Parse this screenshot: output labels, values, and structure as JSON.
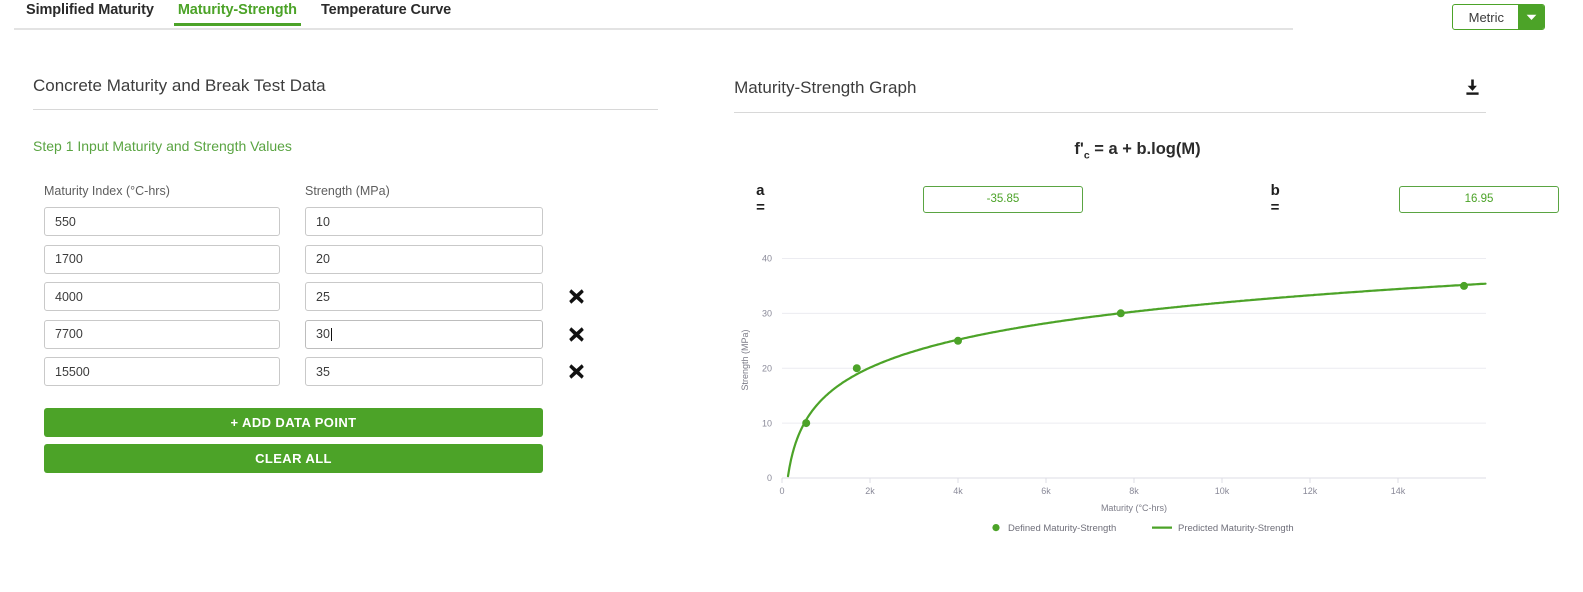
{
  "tabs": [
    {
      "label": "Simplified Maturity",
      "active": false
    },
    {
      "label": "Maturity-Strength",
      "active": true
    },
    {
      "label": "Temperature Curve",
      "active": false
    }
  ],
  "unit_selector": {
    "value": "Metric",
    "caret_icon": "chevron-down-icon"
  },
  "left_panel": {
    "title": "Concrete Maturity and Break Test Data",
    "step_label": "Step 1 Input Maturity and Strength Values",
    "headers": {
      "maturity": "Maturity Index (°C-hrs)",
      "strength": "Strength (MPa)"
    },
    "rows": [
      {
        "maturity": "550",
        "strength": "10",
        "deletable": false,
        "focused": false
      },
      {
        "maturity": "1700",
        "strength": "20",
        "deletable": false,
        "focused": false
      },
      {
        "maturity": "4000",
        "strength": "25",
        "deletable": true,
        "focused": false
      },
      {
        "maturity": "7700",
        "strength": "30",
        "deletable": true,
        "focused": true
      },
      {
        "maturity": "15500",
        "strength": "35",
        "deletable": true,
        "focused": false
      }
    ],
    "delete_icon": "close-x-icon",
    "add_button": "+ ADD DATA POINT",
    "clear_button": "CLEAR ALL"
  },
  "right_panel": {
    "title": "Maturity-Strength Graph",
    "download_icon": "download-icon",
    "formula": {
      "lhs": "f'",
      "lhs_sub": "c",
      "rhs": " = a + b.log(M)"
    },
    "coefficients": [
      {
        "label": "a =",
        "value": "-35.85"
      },
      {
        "label": "b =",
        "value": "16.95"
      }
    ]
  },
  "colors": {
    "green": "#4ca328",
    "green_text": "#5aa442",
    "grid": "#ececf1",
    "axis_text": "#8a8a99"
  },
  "chart_data": {
    "type": "scatter",
    "title": "",
    "xlabel": "Maturity (°C-hrs)",
    "ylabel": "Strength (MPa)",
    "xlim": [
      0,
      16000
    ],
    "ylim": [
      0,
      43
    ],
    "xticks": [
      0,
      2000,
      4000,
      6000,
      8000,
      10000,
      12000,
      14000
    ],
    "xticklabels": [
      "0",
      "2k",
      "4k",
      "6k",
      "8k",
      "10k",
      "12k",
      "14k"
    ],
    "yticks": [
      0,
      10,
      20,
      30,
      40
    ],
    "yticklabels": [
      "0",
      "10",
      "20",
      "30",
      "40"
    ],
    "grid": true,
    "legend_position": "bottom",
    "series": [
      {
        "name": "Defined Maturity-Strength",
        "type": "scatter",
        "color": "#4ca328",
        "x": [
          550,
          1700,
          4000,
          7700,
          15500
        ],
        "y": [
          10,
          20,
          25,
          30,
          35
        ]
      },
      {
        "name": "Predicted Maturity-Strength",
        "type": "line",
        "color": "#4ca328",
        "model": "f'c = a + b.log10(M)",
        "a": -35.85,
        "b": 16.95
      }
    ]
  }
}
